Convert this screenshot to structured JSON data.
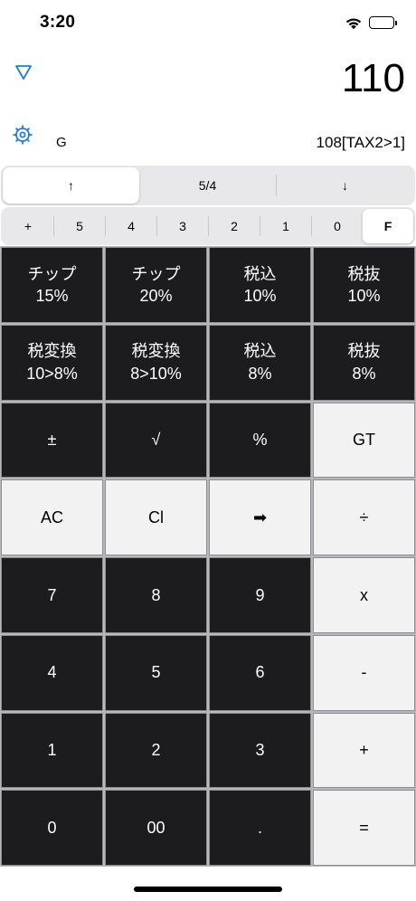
{
  "status_bar": {
    "time": "3:20"
  },
  "display": {
    "main_value": "110",
    "g_label": "G",
    "sub_value": "108[TAX2>1]"
  },
  "segmented": [
    {
      "label": "↑",
      "selected": true
    },
    {
      "label": "5/4",
      "selected": false
    },
    {
      "label": "↓",
      "selected": false
    }
  ],
  "decimals": [
    {
      "label": "+",
      "selected": false
    },
    {
      "label": "5",
      "selected": false
    },
    {
      "label": "4",
      "selected": false
    },
    {
      "label": "3",
      "selected": false
    },
    {
      "label": "2",
      "selected": false
    },
    {
      "label": "1",
      "selected": false
    },
    {
      "label": "0",
      "selected": false
    },
    {
      "label": "F",
      "selected": true
    }
  ],
  "keys": [
    {
      "name": "tip-15-key",
      "line1": "チップ",
      "line2": "15%",
      "style": "dark"
    },
    {
      "name": "tip-20-key",
      "line1": "チップ",
      "line2": "20%",
      "style": "dark"
    },
    {
      "name": "tax-incl-10-key",
      "line1": "税込",
      "line2": "10%",
      "style": "dark"
    },
    {
      "name": "tax-excl-10-key",
      "line1": "税抜",
      "line2": "10%",
      "style": "dark"
    },
    {
      "name": "tax-convert-10-8-key",
      "line1": "税変換",
      "line2": "10>8%",
      "style": "dark"
    },
    {
      "name": "tax-convert-8-10-key",
      "line1": "税変換",
      "line2": "8>10%",
      "style": "dark"
    },
    {
      "name": "tax-incl-8-key",
      "line1": "税込",
      "line2": "8%",
      "style": "dark"
    },
    {
      "name": "tax-excl-8-key",
      "line1": "税抜",
      "line2": "8%",
      "style": "dark"
    },
    {
      "name": "plus-minus-key",
      "line1": "±",
      "line2": "",
      "style": "dark"
    },
    {
      "name": "sqrt-key",
      "line1": "√",
      "line2": "",
      "style": "dark"
    },
    {
      "name": "percent-key",
      "line1": "%",
      "line2": "",
      "style": "dark"
    },
    {
      "name": "gt-key",
      "line1": "GT",
      "line2": "",
      "style": "light"
    },
    {
      "name": "all-clear-key",
      "line1": "AC",
      "line2": "",
      "style": "light"
    },
    {
      "name": "clear-key",
      "line1": "Cl",
      "line2": "",
      "style": "light"
    },
    {
      "name": "backspace-key",
      "line1": "➡",
      "line2": "",
      "style": "light"
    },
    {
      "name": "divide-key",
      "line1": "÷",
      "line2": "",
      "style": "light"
    },
    {
      "name": "digit-7-key",
      "line1": "7",
      "line2": "",
      "style": "dark"
    },
    {
      "name": "digit-8-key",
      "line1": "8",
      "line2": "",
      "style": "dark"
    },
    {
      "name": "digit-9-key",
      "line1": "9",
      "line2": "",
      "style": "dark"
    },
    {
      "name": "multiply-key",
      "line1": "x",
      "line2": "",
      "style": "light"
    },
    {
      "name": "digit-4-key",
      "line1": "4",
      "line2": "",
      "style": "dark"
    },
    {
      "name": "digit-5-key",
      "line1": "5",
      "line2": "",
      "style": "dark"
    },
    {
      "name": "digit-6-key",
      "line1": "6",
      "line2": "",
      "style": "dark"
    },
    {
      "name": "subtract-key",
      "line1": "-",
      "line2": "",
      "style": "light"
    },
    {
      "name": "digit-1-key",
      "line1": "1",
      "line2": "",
      "style": "dark"
    },
    {
      "name": "digit-2-key",
      "line1": "2",
      "line2": "",
      "style": "dark"
    },
    {
      "name": "digit-3-key",
      "line1": "3",
      "line2": "",
      "style": "dark"
    },
    {
      "name": "add-key",
      "line1": "+",
      "line2": "",
      "style": "light"
    },
    {
      "name": "digit-0-key",
      "line1": "0",
      "line2": "",
      "style": "dark"
    },
    {
      "name": "digit-00-key",
      "line1": "00",
      "line2": "",
      "style": "dark"
    },
    {
      "name": "decimal-point-key",
      "line1": ".",
      "line2": "",
      "style": "dark"
    },
    {
      "name": "equals-key",
      "line1": "=",
      "line2": "",
      "style": "light"
    }
  ],
  "colors": {
    "accent": "#1a7de6",
    "dark_key": "#1c1c1e",
    "light_key": "#f2f2f2"
  },
  "icons": {
    "mode": "triangle-down-icon",
    "settings": "gear-icon"
  }
}
